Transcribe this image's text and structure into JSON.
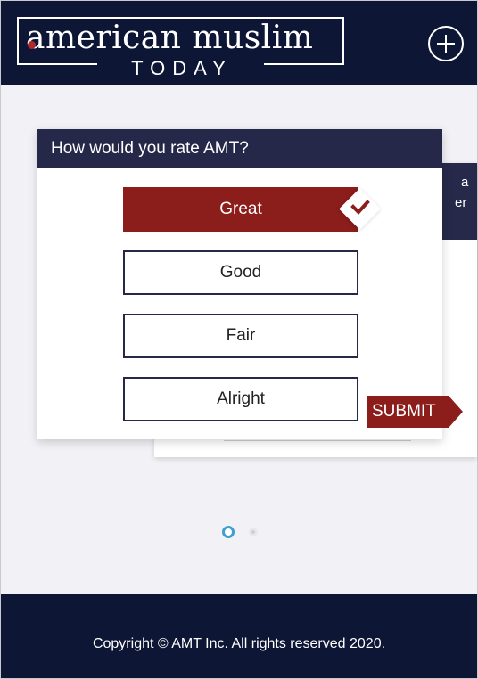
{
  "header": {
    "logo_main": "american muslim",
    "logo_sub": "TODAY",
    "menu_icon": "plus-circle-icon"
  },
  "back_card": {
    "fragment_1": "a",
    "fragment_2": "er"
  },
  "poll": {
    "question": "How would you rate AMT?",
    "options": [
      {
        "label": "Great",
        "selected": true
      },
      {
        "label": "Good",
        "selected": false
      },
      {
        "label": "Fair",
        "selected": false
      },
      {
        "label": "Alright",
        "selected": false
      }
    ],
    "submit_label": "SUBMIT"
  },
  "pagination": {
    "current": 1,
    "total": 2
  },
  "footer": {
    "copyright": "Copyright © AMT Inc. All rights reserved 2020."
  },
  "colors": {
    "navy": "#0e1635",
    "card_header": "#252848",
    "accent_red": "#8b1d1b",
    "active_dot": "#3e9fd0"
  }
}
